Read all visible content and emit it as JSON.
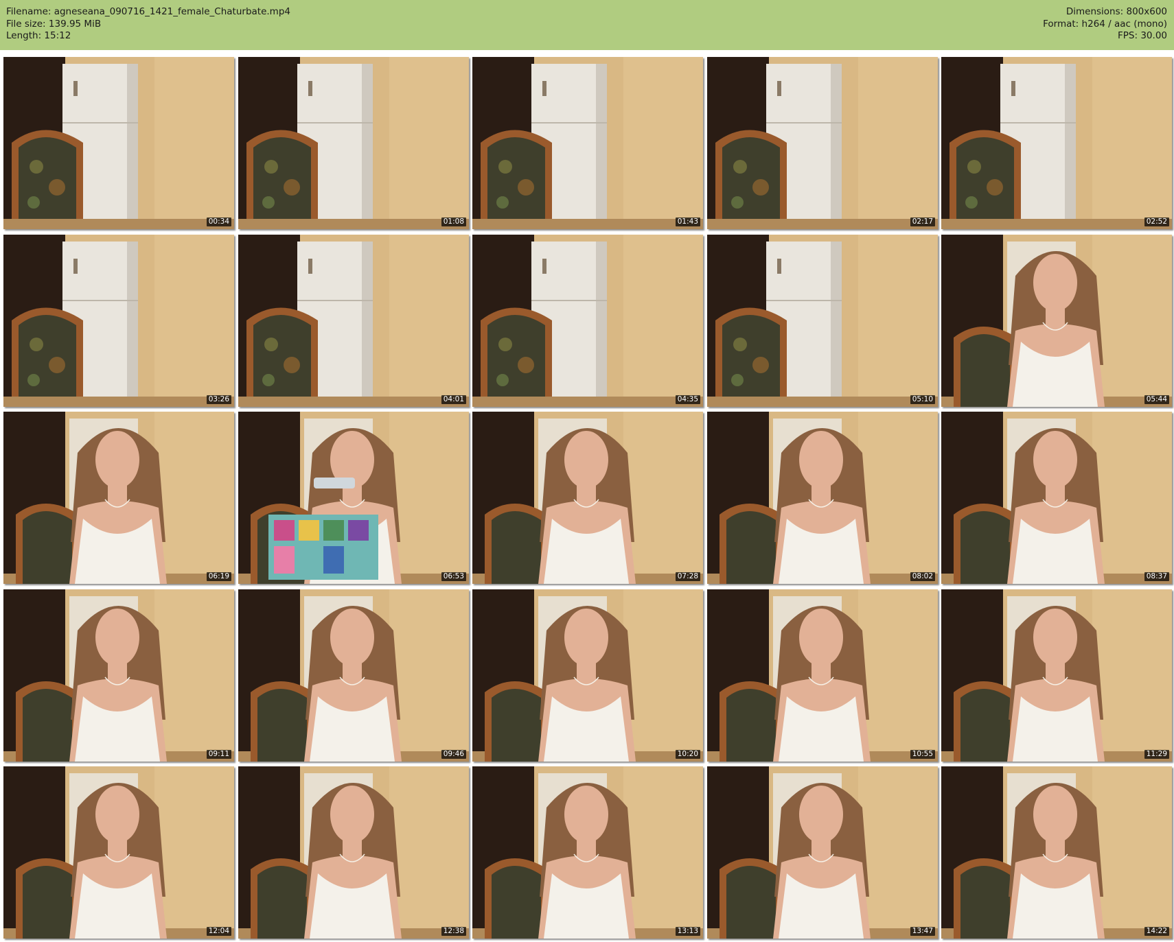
{
  "header": {
    "filename_line": "Filename: agneseana_090716_1421_female_Chaturbate.mp4",
    "filesize_line": "File size: 139.95 MiB",
    "length_line": "Length: 15:12",
    "dimensions_line": "Dimensions: 800x600",
    "format_line": "Format: h264 / aac (mono)",
    "fps_line": "FPS: 30.00"
  },
  "colors": {
    "header_bg": "#b0cc80",
    "wall": "#d9b884",
    "fridge": "#e9e5dd",
    "chair_wood": "#9a5a2c",
    "chair_fabric": "#3f3f2c",
    "dark_room": "#2a1c14",
    "top_white": "#f4f1ea",
    "hair": "#8a6040",
    "skin": "#e2b196"
  },
  "thumbnails": [
    {
      "time": "00:34",
      "scene": "empty"
    },
    {
      "time": "01:08",
      "scene": "empty"
    },
    {
      "time": "01:43",
      "scene": "empty"
    },
    {
      "time": "02:17",
      "scene": "empty"
    },
    {
      "time": "02:52",
      "scene": "empty"
    },
    {
      "time": "03:26",
      "scene": "empty"
    },
    {
      "time": "04:01",
      "scene": "empty"
    },
    {
      "time": "04:35",
      "scene": "empty"
    },
    {
      "time": "05:10",
      "scene": "empty"
    },
    {
      "time": "05:44",
      "scene": "person"
    },
    {
      "time": "06:19",
      "scene": "person"
    },
    {
      "time": "06:53",
      "scene": "person-gift"
    },
    {
      "time": "07:28",
      "scene": "person"
    },
    {
      "time": "08:02",
      "scene": "person"
    },
    {
      "time": "08:37",
      "scene": "person"
    },
    {
      "time": "09:11",
      "scene": "person"
    },
    {
      "time": "09:46",
      "scene": "person"
    },
    {
      "time": "10:20",
      "scene": "person"
    },
    {
      "time": "10:55",
      "scene": "person"
    },
    {
      "time": "11:29",
      "scene": "person"
    },
    {
      "time": "12:04",
      "scene": "person"
    },
    {
      "time": "12:38",
      "scene": "person"
    },
    {
      "time": "13:13",
      "scene": "person"
    },
    {
      "time": "13:47",
      "scene": "person"
    },
    {
      "time": "14:22",
      "scene": "person"
    }
  ]
}
